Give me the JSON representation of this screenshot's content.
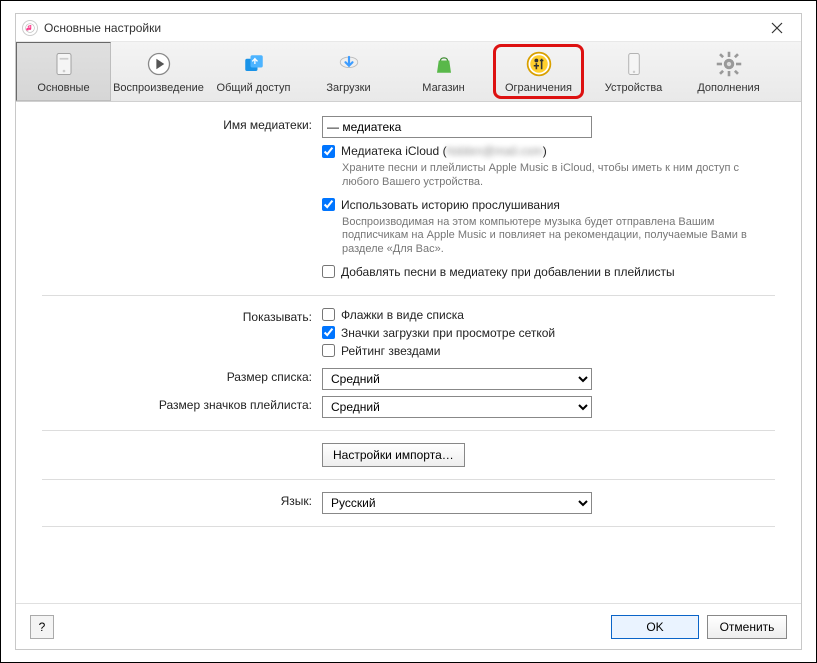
{
  "titlebar": {
    "title": "Основные настройки"
  },
  "toolbar": {
    "general": "Основные",
    "playback": "Воспроизведение",
    "sharing": "Общий доступ",
    "downloads": "Загрузки",
    "store": "Магазин",
    "restrictions": "Ограничения",
    "devices": "Устройства",
    "advanced": "Дополнения"
  },
  "form": {
    "library_name_label": "Имя медиатеки:",
    "library_name_value": "— медиатека",
    "icloud_checkbox": "Медиатека iCloud (",
    "icloud_suffix": ")",
    "icloud_checked": true,
    "icloud_note": "Храните песни и плейлисты Apple Music в iCloud, чтобы иметь к ним доступ с любого Вашего устройства.",
    "history_checkbox": "Использовать историю прослушивания",
    "history_checked": true,
    "history_note": "Воспроизводимая на этом компьютере музыка будет отправлена Вашим подписчикам на Apple Music и повлияет на рекомендации, получаемые Вами в разделе «Для Вас».",
    "add_playlist_checkbox": "Добавлять песни в медиатеку при добавлении в плейлисты",
    "add_playlist_checked": false,
    "show_label": "Показывать:",
    "flags_checkbox": "Флажки в виде списка",
    "flags_checked": false,
    "dlicons_checkbox": "Значки загрузки при просмотре сеткой",
    "dlicons_checked": true,
    "stars_checkbox": "Рейтинг звездами",
    "stars_checked": false,
    "list_size_label": "Размер списка:",
    "list_size_value": "Средний",
    "plist_icon_size_label": "Размер значков плейлиста:",
    "plist_icon_size_value": "Средний",
    "import_button": "Настройки импорта…",
    "language_label": "Язык:",
    "language_value": "Русский"
  },
  "footer": {
    "help": "?",
    "ok": "OK",
    "cancel": "Отменить"
  }
}
